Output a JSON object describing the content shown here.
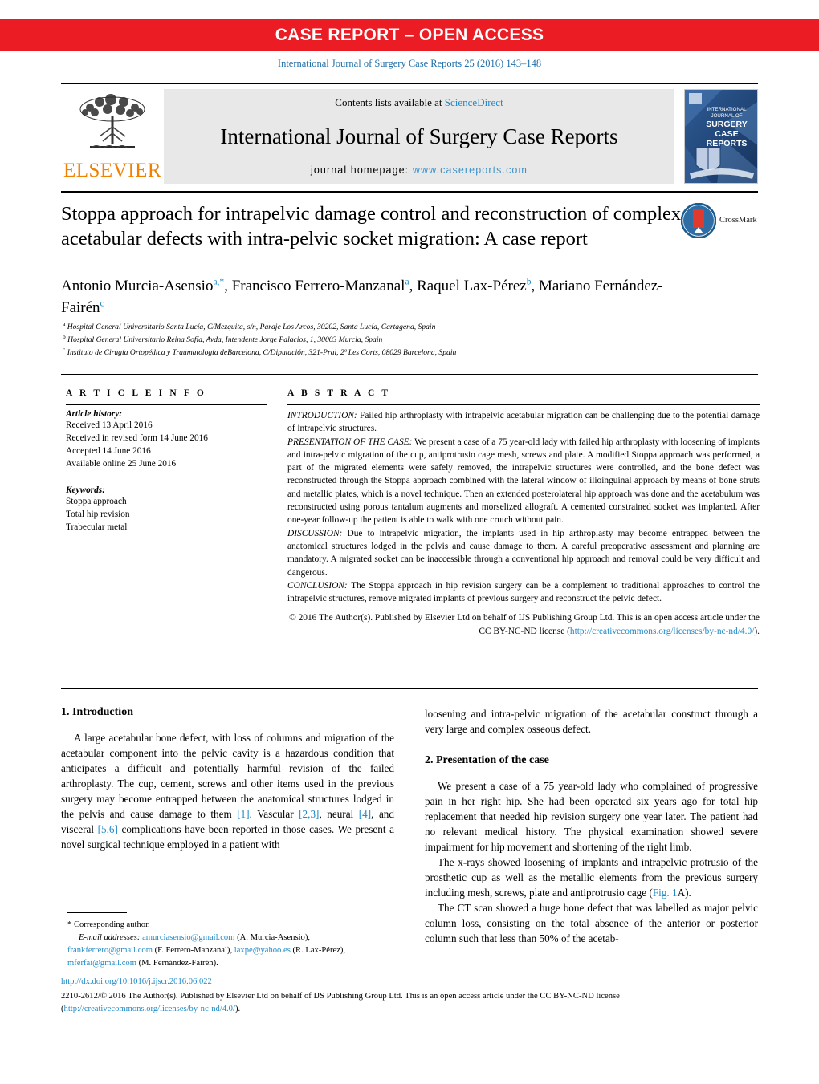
{
  "banner": {
    "label": "CASE REPORT – OPEN ACCESS",
    "color": "#ec1c24"
  },
  "journal_ref": "International Journal of Surgery Case Reports 25 (2016) 143–148",
  "masthead": {
    "publisher": "ELSEVIER",
    "contents_prefix": "Contents lists available at ",
    "contents_link": "ScienceDirect",
    "journal_name": "International Journal of Surgery Case Reports",
    "homepage_prefix": "journal homepage: ",
    "homepage_url": "www.casereports.com",
    "cover_lines": [
      "INTERNATIONAL",
      "JOURNAL OF",
      "SURGERY",
      "CASE",
      "REPORTS"
    ]
  },
  "article": {
    "title": "Stoppa approach for intrapelvic damage control and reconstruction of complex acetabular defects with intra-pelvic socket migration: A case report",
    "crossmark_label": "CrossMark",
    "authors_html": "Antonio Murcia-Asensio<sup>a,*</sup>, Francisco Ferrero-Manzanal<sup>a</sup>, Raquel Lax-Pérez<sup>b</sup>, Mariano Fernández-Fairén<sup>c</sup>",
    "affiliations": [
      "Hospital General Universitario Santa Lucía, C/Mezquita, s/n, Paraje Los Arcos, 30202, Santa Lucía, Cartagena, Spain",
      "Hospital General Universitario Reina Sofía, Avda, Intendente Jorge Palacios, 1, 30003 Murcia, Spain",
      "Instituto de Cirugía Ortopédica y Traumatología deBarcelona, C/Diputación, 321-Pral, 2ª Les Corts, 08029 Barcelona, Spain"
    ],
    "affiliation_marks": [
      "a",
      "b",
      "c"
    ]
  },
  "article_info": {
    "heading": "A R T I C L E   I N F O",
    "history_label": "Article history:",
    "history": [
      "Received 13 April 2016",
      "Received in revised form 14 June 2016",
      "Accepted 14 June 2016",
      "Available online 25 June 2016"
    ],
    "keywords_label": "Keywords:",
    "keywords": [
      "Stoppa approach",
      "Total hip revision",
      "Trabecular metal"
    ]
  },
  "abstract": {
    "heading": "A B S T R A C T",
    "sections": [
      {
        "label": "INTRODUCTION:",
        "text": " Failed hip arthroplasty with intrapelvic acetabular migration can be challenging due to the potential damage of intrapelvic structures."
      },
      {
        "label": "PRESENTATION OF THE CASE:",
        "text": " We present a case of a 75 year-old lady with failed hip arthroplasty with loosening of implants and intra-pelvic migration of the cup, antiprotrusio cage mesh, screws and plate. A modified Stoppa approach was performed, a part of the migrated elements were safely removed, the intrapelvic structures were controlled, and the bone defect was reconstructed through the Stoppa approach combined with the lateral window of ilioinguinal approach by means of bone struts and metallic plates, which is a novel technique. Then an extended posterolateral hip approach was done and the acetabulum was reconstructed using porous tantalum augments and morselized allograft. A cemented constrained socket was implanted. After one-year follow-up the patient is able to walk with one crutch without pain."
      },
      {
        "label": "DISCUSSION:",
        "text": " Due to intrapelvic migration, the implants used in hip arthroplasty may become entrapped between the anatomical structures lodged in the pelvis and cause damage to them. A careful preoperative assessment and planning are mandatory. A migrated socket can be inaccessible through a conventional hip approach and removal could be very difficult and dangerous."
      },
      {
        "label": "CONCLUSION:",
        "text": " The Stoppa approach in hip revision surgery can be a complement to traditional approaches to control the intrapelvic structures, remove migrated implants of previous surgery and reconstruct the pelvic defect."
      }
    ],
    "copyright_part1": "© 2016 The Author(s). Published by Elsevier Ltd on behalf of IJS Publishing Group Ltd. This is an open access article under the CC BY-NC-ND license (",
    "copyright_link": "http://creativecommons.org/licenses/by-nc-nd/4.0/",
    "copyright_part2": ")."
  },
  "body": {
    "left": {
      "section1_heading": "1.  Introduction",
      "para1_a": "A large acetabular bone defect, with loss of columns and migration of the acetabular component into the pelvic cavity is a hazardous condition that anticipates a difficult and potentially harmful revision of the failed arthroplasty. The cup, cement, screws and other items used in the previous surgery may become entrapped between the anatomical structures lodged in the pelvis and cause damage to them ",
      "ref1": "[1]",
      "para1_b": ". Vascular ",
      "ref2": "[2,3]",
      "para1_c": ", neural ",
      "ref3": "[4]",
      "para1_d": ", and visceral ",
      "ref4": "[5,6]",
      "para1_e": " complications have been reported in those cases. We present a novel surgical technique employed in a patient with"
    },
    "right": {
      "para_cont": "loosening and intra-pelvic migration of the acetabular construct through a very large and complex osseous defect.",
      "section2_heading": "2.  Presentation of the case",
      "para2": "We present a case of a 75 year-old lady who complained of progressive pain in her right hip. She had been operated six years ago for total hip replacement that needed hip revision surgery one year later. The patient had no relevant medical history. The physical examination showed severe impairment for hip movement and shortening of the right limb.",
      "para3_a": "The x-rays showed loosening of implants and intrapelvic protrusio of the prosthetic cup as well as the metallic elements from the previous surgery including mesh, screws, plate and antiprotrusio cage (",
      "para3_fig": "Fig. 1",
      "para3_b": "A).",
      "para4": "The CT scan showed a huge bone defect that was labelled as major pelvic column loss, consisting on the total absence of the anterior or posterior column such that less than 50% of the acetab-"
    }
  },
  "footnotes": {
    "corresponding": "*  Corresponding author.",
    "email_label": "E-mail addresses:",
    "emails": [
      {
        "address": "amurciasensio@gmail.com",
        "owner": "(A. Murcia-Asensio),"
      },
      {
        "address": "frankferrero@gmail.com",
        "owner": "(F. Ferrero-Manzanal),"
      },
      {
        "address": "laxpe@yahoo.es",
        "owner": "(R. Lax-Pérez),"
      },
      {
        "address": "mferfai@gmail.com",
        "owner": "(M. Fernández-Fairén)."
      }
    ]
  },
  "footer": {
    "doi": "http://dx.doi.org/10.1016/j.ijscr.2016.06.022",
    "issn_line": "2210-2612/© 2016 The Author(s). Published by Elsevier Ltd on behalf of IJS Publishing Group Ltd. This is an open access article under the CC BY-NC-ND license (",
    "license_link": "http://creativecommons.org/licenses/by-nc-nd/4.0/",
    "issn_line_end": ")."
  },
  "colors": {
    "banner_red": "#ec1c24",
    "link_blue": "#1f8ac7",
    "elsevier_orange": "#f08000",
    "masthead_grey": "#e8e8e8"
  }
}
